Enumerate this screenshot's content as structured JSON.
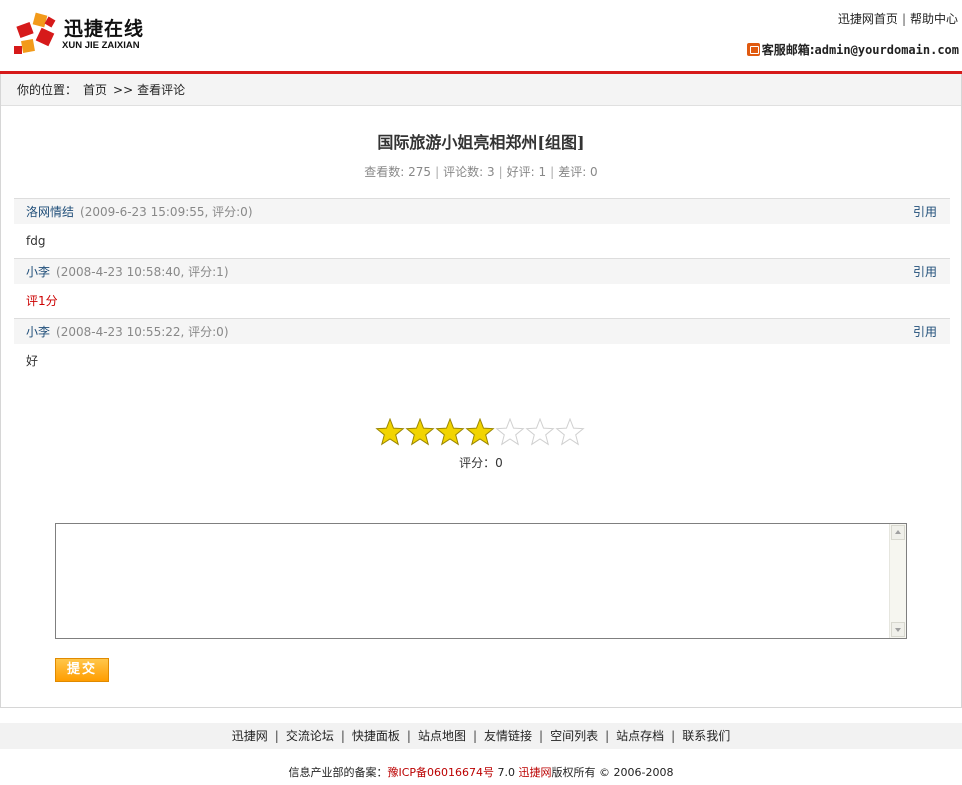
{
  "header": {
    "logo_cn": "迅捷在线",
    "logo_en": "XUN  JIE  ZAIXIAN",
    "topnav": [
      "迅捷网首页",
      "帮助中心"
    ],
    "mail_label": "客服邮箱:",
    "mail_addr": "admin@yourdomain.com"
  },
  "breadcrumb": {
    "label": "你的位置：",
    "home": "首页",
    "sep": ">>",
    "current": "查看评论"
  },
  "article": {
    "title": "国际旅游小姐亮相郑州[组图]",
    "stats": [
      "查看数: 275",
      "评论数: 3",
      "好评: 1",
      "差评: 0"
    ]
  },
  "comments": [
    {
      "user": "洛网情结",
      "meta": "(2009-6-23 15:09:55, 评分:0)",
      "quote": "引用",
      "body": "fdg"
    },
    {
      "user": "小李",
      "meta": "(2008-4-23 10:58:40, 评分:1)",
      "quote": "引用",
      "body": "评1分"
    },
    {
      "user": "小李",
      "meta": "(2008-4-23 10:55:22, 评分:0)",
      "quote": "引用",
      "body": "好"
    }
  ],
  "rating": {
    "filled_stars": 4,
    "total_stars": 7,
    "label": "评分：0",
    "star_color": "#f2d400"
  },
  "form": {
    "submit_label": "提交"
  },
  "footer": {
    "links": [
      "迅捷网",
      "交流论坛",
      "快捷面板",
      "站点地图",
      "友情链接",
      "空间列表",
      "站点存档",
      "联系我们"
    ],
    "beian_label": "信息产业部的备案：",
    "beian_no": "豫ICP备06016674号",
    "version": "7.0",
    "site": "迅捷网",
    "rights": "版权所有 © 2006-2008"
  },
  "colors": {
    "accent_red": "#d61a1a",
    "link_blue": "#1f4e79",
    "button_orange": "#ff9d00"
  }
}
